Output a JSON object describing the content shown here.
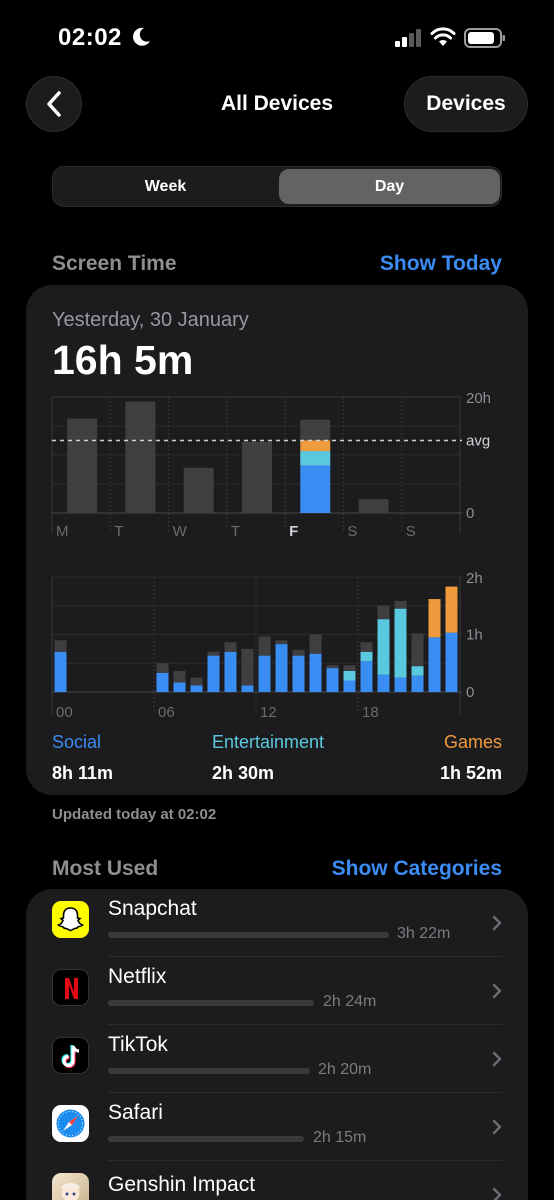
{
  "status": {
    "time": "02:02"
  },
  "nav": {
    "title": "All Devices",
    "devices_label": "Devices"
  },
  "segments": {
    "week": "Week",
    "day": "Day",
    "selected": "Day"
  },
  "screen_time": {
    "section_label": "Screen Time",
    "show_today": "Show Today",
    "date": "Yesterday, 30 January",
    "total": "16h 5m"
  },
  "chart_data": [
    {
      "type": "bar",
      "categories": [
        "M",
        "T",
        "W",
        "T",
        "F",
        "S",
        "S"
      ],
      "values": [
        16.3,
        19.2,
        7.8,
        12.3,
        16.1,
        2.4,
        0
      ],
      "highlight": "F",
      "breakdown_F": {
        "Social": 8.18,
        "Entertainment": 2.5,
        "Games": 1.87
      },
      "y_ticks": [
        "20h",
        "avg",
        "0"
      ],
      "average": 12.5,
      "ylim": [
        0,
        20
      ],
      "colors": {
        "other": "#3f3f42",
        "social": "#3a8df2",
        "entertainment": "#5ac8de",
        "games": "#f09a3e"
      }
    },
    {
      "type": "bar",
      "stacked": true,
      "x_ticks": [
        "00",
        "06",
        "12",
        "18"
      ],
      "y_ticks": [
        "2h",
        "1h",
        "0"
      ],
      "ylim": [
        0,
        120
      ],
      "hours": [
        0,
        1,
        2,
        3,
        4,
        5,
        6,
        7,
        8,
        9,
        10,
        11,
        12,
        13,
        14,
        15,
        16,
        17,
        18,
        19,
        20,
        21,
        22,
        23
      ],
      "social": [
        42,
        0,
        0,
        0,
        0,
        0,
        20,
        10,
        7,
        38,
        42,
        7,
        38,
        50,
        38,
        40,
        25,
        12,
        32,
        18,
        15,
        17,
        57,
        62
      ],
      "entertainment": [
        0,
        0,
        0,
        0,
        0,
        0,
        0,
        0,
        0,
        0,
        0,
        0,
        0,
        0,
        0,
        0,
        0,
        10,
        10,
        58,
        72,
        10,
        0,
        0
      ],
      "games": [
        0,
        0,
        0,
        0,
        0,
        0,
        0,
        0,
        0,
        0,
        0,
        0,
        0,
        0,
        0,
        0,
        0,
        0,
        0,
        0,
        0,
        0,
        40,
        48
      ],
      "other": [
        12,
        0,
        0,
        0,
        0,
        0,
        10,
        12,
        8,
        4,
        10,
        38,
        20,
        4,
        6,
        20,
        3,
        6,
        10,
        14,
        8,
        34,
        0,
        0
      ]
    }
  ],
  "legend": [
    {
      "name": "Social",
      "value": "8h 11m",
      "color": "#3b8cf5"
    },
    {
      "name": "Entertainment",
      "value": "2h 30m",
      "color": "#5ac8de"
    },
    {
      "name": "Games",
      "value": "1h 52m",
      "color": "#f09a3e"
    }
  ],
  "updated": "Updated today at 02:02",
  "most_used": {
    "section_label": "Most Used",
    "show_categories": "Show Categories",
    "apps": [
      {
        "name": "Snapchat",
        "time": "3h 22m",
        "fraction": 1.0,
        "icon": "snapchat-icon"
      },
      {
        "name": "Netflix",
        "time": "2h 24m",
        "fraction": 0.71,
        "icon": "netflix-icon"
      },
      {
        "name": "TikTok",
        "time": "2h 20m",
        "fraction": 0.69,
        "icon": "tiktok-icon"
      },
      {
        "name": "Safari",
        "time": "2h 15m",
        "fraction": 0.67,
        "icon": "safari-icon"
      },
      {
        "name": "Genshin Impact",
        "time": "",
        "fraction": 0.5,
        "icon": "genshin-impact-icon"
      }
    ]
  }
}
